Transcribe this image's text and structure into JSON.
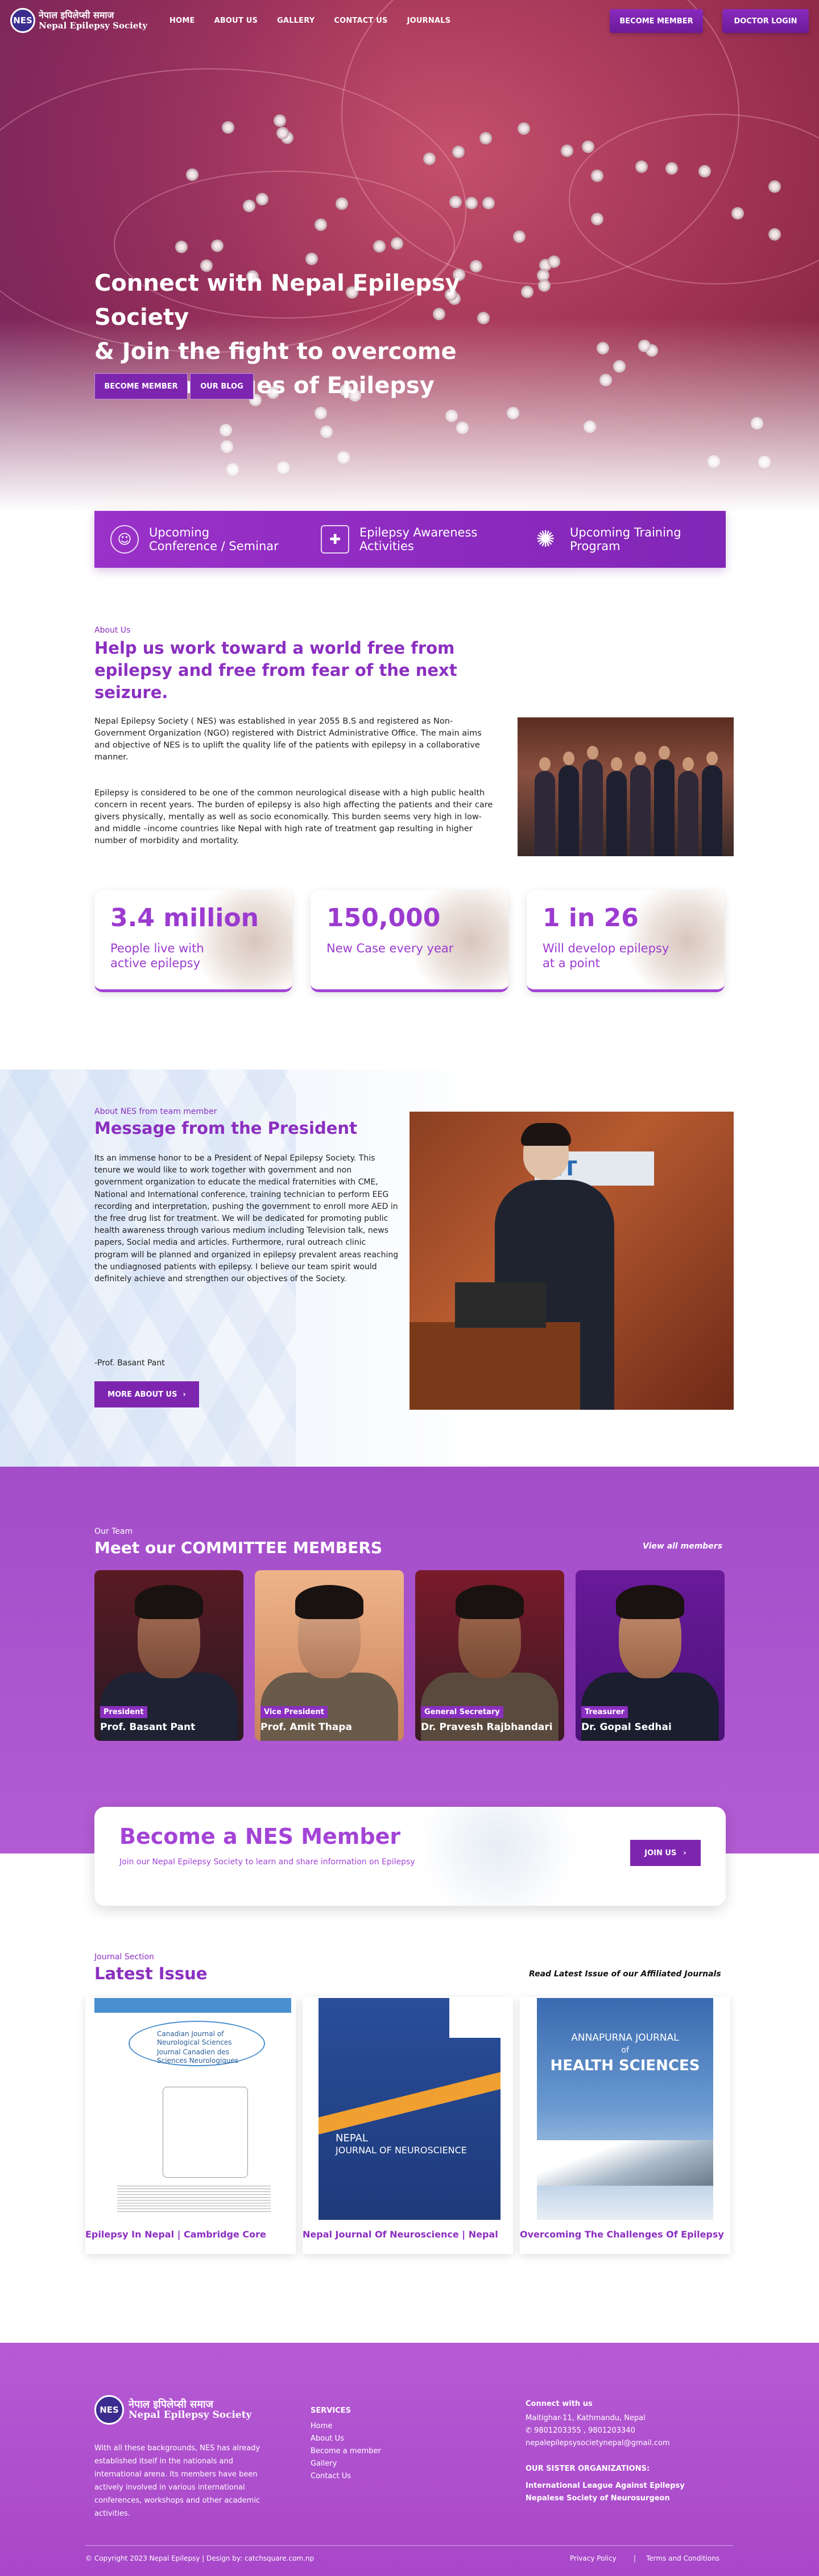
{
  "logo": {
    "line1": "नेपाल इपिलेप्सी समाज",
    "line2": "Nepal Epilepsy Society",
    "badge": "NES"
  },
  "nav": {
    "items": [
      "HOME",
      "ABOUT US",
      "GALLERY",
      "CONTACT US",
      "JOURNALS"
    ],
    "become_member": "BECOME MEMBER",
    "doctor_login": "DOCTOR LOGIN"
  },
  "hero": {
    "title_lines": [
      "Connect with Nepal Epilepsy Society",
      "& Join the fight to overcome",
      "the Challenges of Epilepsy"
    ],
    "btn_member": "BECOME MEMBER",
    "btn_blog": "OUR BLOG"
  },
  "features": [
    {
      "icon": "brain-head-icon",
      "line1": "Upcoming",
      "line2": "Conference / Seminar"
    },
    {
      "icon": "medical-kit-icon",
      "line1": "Epilepsy Awareness",
      "line2": "Activities"
    },
    {
      "icon": "sun-burst-icon",
      "line1": "Upcoming Training",
      "line2": "Program"
    }
  ],
  "about": {
    "kicker": "About Us",
    "heading_lines": [
      "Help us work toward a world free from",
      "epilepsy and free from fear of the next",
      "seizure."
    ],
    "p1": "Nepal Epilepsy Society ( NES) was established in year 2055 B.S and registered as Non-Government Organization (NGO) registered with District Administrative Office. The main aims and objective of NES is to uplift the quality life of the patients with epilepsy in a collaborative manner.",
    "p2": "Epilepsy is considered to be one of the common neurological disease with a high public health concern in recent years. The burden of epilepsy is also high affecting the patients and their care givers physically, mentally as well as socio economically. This burden seems very high in low- and middle –income countries like Nepal with high rate of treatment gap resulting in higher number of morbidity and mortality."
  },
  "stats": [
    {
      "num": "3.4 million",
      "label": "People live with active epilepsy"
    },
    {
      "num": "150,000",
      "label": "New Case every year"
    },
    {
      "num": "1 in 26",
      "label": "Will develop epilepsy at a point"
    }
  ],
  "president": {
    "kicker": "About NES from team member",
    "heading": "Message from the President",
    "body": "Its an immense honor to be a President of Nepal Epilepsy Society. This tenure we would like to work together with government and non government organization to educate the medical fraternities with CME, National and International conference, training technician to perform EEG recording and interpretation, pushing the government to enroll more AED in the free drug list for treatment. We will be dedicated for promoting public health awareness through various medium including Television talk, news papers, Social media and articles. Furthermore, rural outreach clinic program will be planned and organized in epilepsy prevalent areas reaching the undiagnosed patients with epilepsy. I believe our team spirit would definitely achieve and strengthen our objectives of the Society.",
    "sign": "-Prof. Basant Pant",
    "more": "MORE ABOUT US"
  },
  "committee": {
    "kicker": "Our Team",
    "heading": "Meet our COMMITTEE MEMBERS",
    "view_all": "View all members",
    "members": [
      {
        "role": "President",
        "name": "Prof. Basant Pant"
      },
      {
        "role": "Vice President",
        "name": "Prof. Amit Thapa"
      },
      {
        "role": "General Secretary",
        "name": "Dr. Pravesh Rajbhandari"
      },
      {
        "role": "Treasurer",
        "name": "Dr. Gopal Sedhai"
      }
    ]
  },
  "member_box": {
    "title": "Become a NES Member",
    "sub": "Join our Nepal Epilepsy Society to learn and share information on Epilepsy",
    "join": "JOIN US"
  },
  "journals": {
    "kicker": "Journal Section",
    "heading": "Latest Issue",
    "right": "Read Latest Issue of our Affiliated Journals",
    "items": [
      {
        "title": "Epilepsy In Nepal | Cambridge Core",
        "cover1": "Canadian Journal of Neurological Sciences",
        "cover2": "Journal Canadien des Sciences Neurologiques"
      },
      {
        "title": "Nepal Journal Of Neuroscience | Nepal",
        "cover1": "NEPAL",
        "cover2": "JOURNAL OF NEUROSCIENCE"
      },
      {
        "title": "Overcoming The Challenges Of Epilepsy",
        "cover1": "ANNAPURNA JOURNAL",
        "cover2": "HEALTH SCIENCES",
        "cover_of": "of"
      }
    ]
  },
  "footer": {
    "about": "With all these backgrounds, NES has already established itself in the nationals and international arena. Its members have been actively involved in various international conferences, workshops and other academic activities.",
    "services_h": "SERVICES",
    "services": [
      "Home",
      "About Us",
      "Become a member",
      "Gallery",
      "Contact Us"
    ],
    "connect_h": "Connect with us",
    "address": "Maitighar-11, Kathmandu, Nepal",
    "phone": "9801203355 , 9801203340",
    "email": "nepalepilepsysocietynepal@gmail.com",
    "sister_h": "OUR SISTER ORGANIZATIONS:",
    "sister1": "International League Against Epilepsy",
    "sister2": "Nepalese Society of Neurosurgeon",
    "copyright": "© Copyright 2023 Nepal Epilepsy | Design by: catchsquare.com.np",
    "privacy": "Privacy Policy",
    "terms": "Terms and Conditions"
  },
  "colors": {
    "accent": "#8b2fc0",
    "hero": "#a53658",
    "footer": "#b65ad4"
  }
}
